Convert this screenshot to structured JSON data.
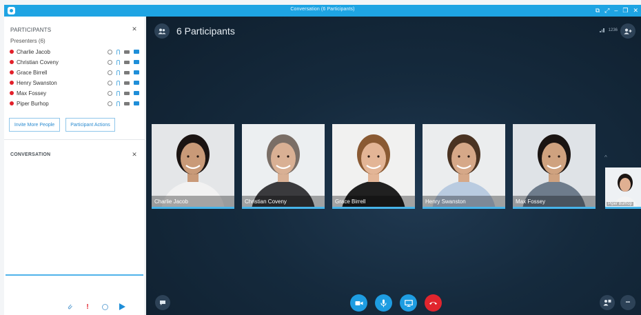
{
  "window": {
    "title": "Conversation (6 Participants)",
    "controls": [
      "⧉",
      "⤢",
      "–",
      "❐",
      "✕"
    ]
  },
  "sidebar": {
    "participants_header": "PARTICIPANTS",
    "presenters_label": "Presenters (6)",
    "participants": [
      {
        "name": "Charlie Jacob"
      },
      {
        "name": "Christian Coveny"
      },
      {
        "name": "Grace Birrell"
      },
      {
        "name": "Henry Swanston"
      },
      {
        "name": "Max Fossey"
      },
      {
        "name": "Piper Burhop"
      }
    ],
    "invite_button": "Invite More People",
    "actions_button": "Participant Actions",
    "conversation_header": "CONVERSATION",
    "close_glyph": "✕"
  },
  "stage": {
    "title": "6 Participants",
    "status_text": "1236",
    "overflow_indicator": "^",
    "tiles": [
      {
        "name": "Charlie Jacob",
        "skin": "#c99a78",
        "hair": "#1b1412",
        "shirt": "#f2f2f2",
        "bg": "#e4e6e8"
      },
      {
        "name": "Christian Coveny",
        "skin": "#d9b094",
        "hair": "#7a6e66",
        "shirt": "#3a3a3d",
        "bg": "#eceff1"
      },
      {
        "name": "Grace Birrell",
        "skin": "#e3b596",
        "hair": "#8a5a33",
        "shirt": "#202020",
        "bg": "#f1f1f0"
      },
      {
        "name": "Henry Swanston",
        "skin": "#d6a888",
        "hair": "#4a3322",
        "shirt": "#b9cbe0",
        "bg": "#ebedee"
      },
      {
        "name": "Max Fossey",
        "skin": "#cfa27f",
        "hair": "#1a1412",
        "shirt": "#6e7c8c",
        "bg": "#dfe3e7"
      }
    ],
    "small_tile": {
      "name": "Piper Burhop",
      "skin": "#e0b092",
      "hair": "#1a1412",
      "shirt": "#f4f4f4"
    }
  },
  "colors": {
    "accent": "#1ea4e3",
    "presence_busy": "#e2202a",
    "hangup": "#e1252e",
    "speaking_bar": "#46b4ea"
  },
  "icons": {
    "im": "chat-bubble-icon",
    "video": "video-camera-icon",
    "mic": "microphone-icon",
    "present": "present-screen-icon",
    "hangup": "hang-up-icon",
    "layout": "layout-people-icon",
    "more": "more-options-icon"
  },
  "more_glyph": "•••"
}
